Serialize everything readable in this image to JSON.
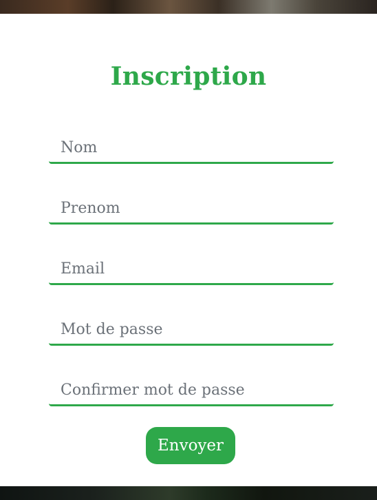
{
  "form": {
    "title": "Inscription",
    "fields": {
      "nom": {
        "placeholder": "Nom",
        "value": ""
      },
      "prenom": {
        "placeholder": "Prenom",
        "value": ""
      },
      "email": {
        "placeholder": "Email",
        "value": ""
      },
      "mot_de_passe": {
        "placeholder": "Mot de passe",
        "value": ""
      },
      "confirmer": {
        "placeholder": "Confirmer mot de passe",
        "value": ""
      }
    },
    "submit_label": "Envoyer"
  },
  "colors": {
    "accent": "#2ea84a",
    "background": "#ffffff",
    "placeholder": "#6b7178"
  }
}
